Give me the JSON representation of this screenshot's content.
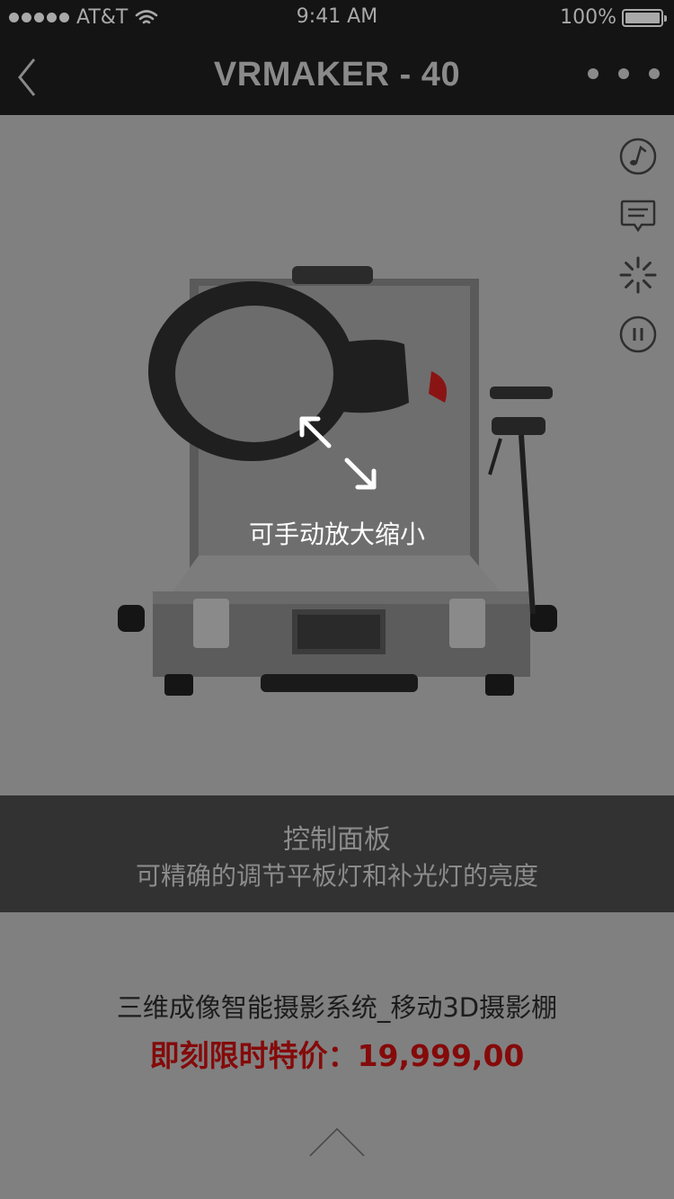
{
  "status_bar": {
    "carrier": "AT&T",
    "time": "9:41 AM",
    "battery_percent": "100%",
    "battery_level": 1.0,
    "icons": [
      "signal-dots-icon",
      "wifi-icon",
      "battery-icon"
    ]
  },
  "nav": {
    "title": "VRMAKER - 40",
    "back_icon": "chevron-left-icon",
    "more_icon": "more-dots-icon"
  },
  "viewer": {
    "side_icons": [
      "music-note-icon",
      "comment-icon",
      "loading-spinner-icon",
      "pause-icon"
    ],
    "zoom_hint": "可手动放大缩小",
    "zoom_icon": "expand-arrows-icon",
    "product_image": "photo-studio-case-with-ring-light"
  },
  "caption": {
    "title": "控制面板",
    "description": "可精确的调节平板灯和补光灯的亮度"
  },
  "product": {
    "name": "三维成像智能摄影系统_移动3D摄影棚",
    "price_label": "即刻限时特价：",
    "price_value": "19,999,00",
    "scroll_up_icon": "chevron-up-icon"
  },
  "colors": {
    "bar_background": "#141414",
    "page_background": "#808080",
    "caption_background": "#323232",
    "price_red": "#850a0a"
  }
}
